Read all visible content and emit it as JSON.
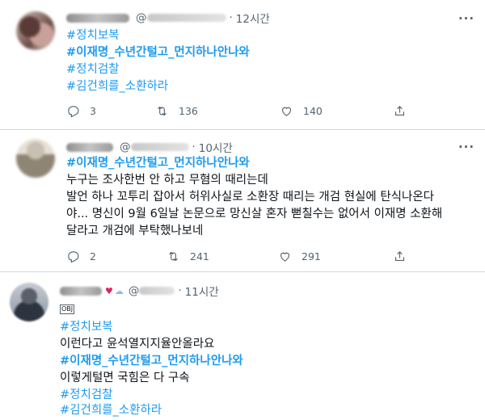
{
  "tweets": [
    {
      "handle_prefix": "@",
      "time": "12시간",
      "lines": [
        {
          "text": "#정치보복",
          "kind": "tag"
        },
        {
          "text": "#이재명_수년간털고_먼지하나안나와",
          "kind": "tag-bold"
        },
        {
          "text": "#정치검찰",
          "kind": "tag"
        },
        {
          "text": "#김건희를_소환하라",
          "kind": "tag"
        }
      ],
      "replies": "3",
      "retweets": "136",
      "likes": "140"
    },
    {
      "handle_prefix": "@",
      "time": "10시간",
      "lines": [
        {
          "text": "#이재명_수년간털고_먼지하나안나와",
          "kind": "tag-bold"
        },
        {
          "text": "누구는 조사한번 안 하고 무혐의 때리는데",
          "kind": "text"
        },
        {
          "text": "발언 하나 꼬투리 잡아서 허위사실로 소환장 때리는 개검 현실에 탄식나온다",
          "kind": "text"
        },
        {
          "text": "야... 명신이 9월 6일날 논문으로 망신살 혼자 뻗칠수는 없어서 이재명 소환해",
          "kind": "text"
        },
        {
          "text": "달라고 개검에 부탁했나보네",
          "kind": "text"
        }
      ],
      "replies": "2",
      "retweets": "241",
      "likes": "291"
    },
    {
      "handle_prefix": "@",
      "time": "11시간",
      "obj_label": "OBJ",
      "lines": [
        {
          "text": "#정치보복",
          "kind": "tag"
        },
        {
          "text": "이런다고 윤석열지지율안올라요",
          "kind": "text"
        },
        {
          "text": "#이재명_수년간털고_먼지하나안나와",
          "kind": "tag-bold"
        },
        {
          "text": "이렇게털면 국힘은 다 구속",
          "kind": "text"
        },
        {
          "text": "#정치검찰",
          "kind": "tag"
        },
        {
          "text": "#김건희를_소환하라",
          "kind": "tag"
        }
      ]
    }
  ],
  "icons": {
    "reply": "reply-icon",
    "retweet": "retweet-icon",
    "like": "heart-icon",
    "share": "share-icon",
    "more": "more-icon"
  },
  "colors": {
    "hashtag": "#1d9bf0",
    "secondary": "#536471",
    "separator": "#cfd9de"
  }
}
